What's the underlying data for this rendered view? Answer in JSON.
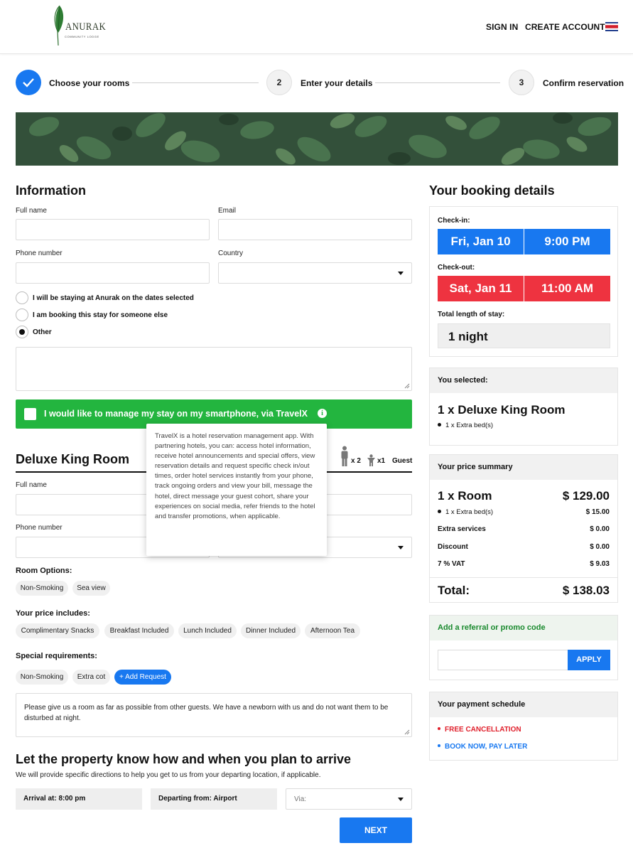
{
  "header": {
    "logo_name": "ANURAK",
    "logo_sub": "COMMUNITY LODGE",
    "sign_in": "SIGN IN",
    "create_account": "CREATE ACCOUNT"
  },
  "stepper": {
    "steps": [
      {
        "number": "1",
        "label": "Choose your rooms",
        "done": true
      },
      {
        "number": "2",
        "label": "Enter your details",
        "done": false
      },
      {
        "number": "3",
        "label": "Confirm reservation",
        "done": false
      }
    ]
  },
  "information": {
    "title": "Information",
    "full_name_label": "Full name",
    "email_label": "Email",
    "phone_label": "Phone number",
    "country_label": "Country",
    "radios": [
      {
        "label": "I will be staying at Anurak on the dates selected",
        "selected": false
      },
      {
        "label": "I am booking this stay for someone else",
        "selected": false
      },
      {
        "label": "Other",
        "selected": true
      }
    ]
  },
  "travelx": {
    "label": "I would like to manage my stay on my smartphone, via TravelX",
    "info_glyph": "i",
    "tooltip": "TravelX is a hotel reservation management app. With partnering hotels, you can: access hotel information, receive hotel announcements and special offers, view reservation details and request specific check in/out times, order hotel services instantly from your phone, track ongoing orders and view your bill, message the hotel, direct message your guest cohort, share your experiences on social media, refer friends to the hotel and transfer promotions, when applicable."
  },
  "room": {
    "title": "Deluxe King Room",
    "adults": "x 2",
    "children": "x1",
    "guest_label": "Guest",
    "full_name_label": "Full name",
    "phone_label": "Phone number",
    "room_options_label": "Room Options:",
    "room_options": [
      "Non-Smoking",
      "Sea view"
    ],
    "price_includes_label": "Your price includes:",
    "price_includes": [
      "Complimentary Snacks",
      "Breakfast Included",
      "Lunch Included",
      "Dinner Included",
      "Afternoon Tea"
    ],
    "special_label": "Special requirements:",
    "special": [
      "Non-Smoking",
      "Extra cot"
    ],
    "add_request": "+ Add Request",
    "request_text": "Please give us a room as far as possible from other guests. We have a newborn with us and do not want them to be disturbed at night."
  },
  "arrival": {
    "title": "Let the property know how and when you plan to arrive",
    "subtitle": "We will provide specific directions to help you get to us from your departing location, if applicable.",
    "arrival_at": "Arrival at: 8:00 pm",
    "departing_from": "Departing from: Airport",
    "via_placeholder": "Via:",
    "next": "NEXT"
  },
  "booking": {
    "title": "Your booking details",
    "checkin_label": "Check-in:",
    "checkin_date": "Fri, Jan 10",
    "checkin_time": "9:00 PM",
    "checkout_label": "Check-out:",
    "checkout_date": "Sat, Jan 11",
    "checkout_time": "11:00 AM",
    "length_label": "Total length of stay:",
    "length": "1 night",
    "colors": {
      "checkin": "#1878f0",
      "checkout": "#ee3340"
    }
  },
  "selected": {
    "head": "You selected:",
    "room": "1 x Deluxe King Room",
    "extra": "1 x Extra bed(s)"
  },
  "price": {
    "head": "Your price summary",
    "room_label": "1 x Room",
    "room_price": "$ 129.00",
    "extra_label": "1 x Extra bed(s)",
    "extra_price": "$ 15.00",
    "rows": [
      {
        "label": "Extra services",
        "value": "$ 0.00"
      },
      {
        "label": "Discount",
        "value": "$ 0.00"
      },
      {
        "label": "7 % VAT",
        "value": "$ 9.03"
      }
    ],
    "total_label": "Total:",
    "total": "$ 138.03"
  },
  "promo": {
    "head": "Add a referral or promo code",
    "apply": "APPLY",
    "head_color": "#1a8a2e"
  },
  "schedule": {
    "head": "Your payment schedule",
    "items": [
      {
        "label": "FREE CANCELLATION",
        "color": "#e0202c"
      },
      {
        "label": "BOOK NOW, PAY LATER",
        "color": "#1878f0"
      }
    ]
  }
}
